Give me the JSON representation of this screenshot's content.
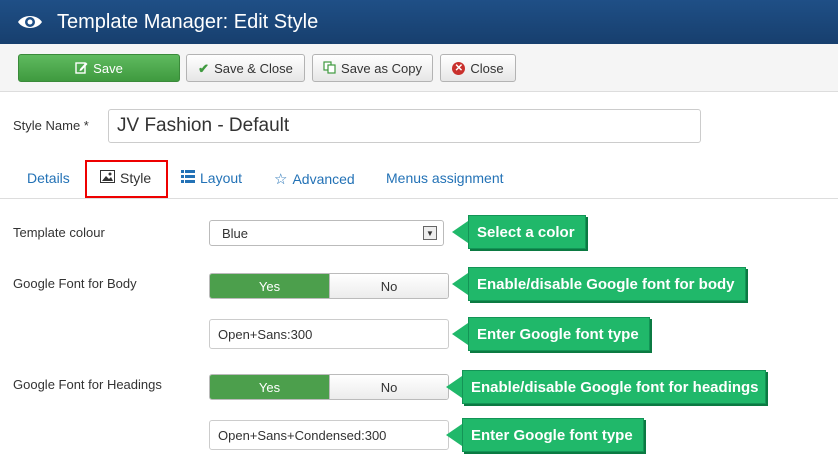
{
  "header": {
    "title": "Template Manager: Edit Style",
    "icon": "eye-icon"
  },
  "toolbar": {
    "save_label": "Save",
    "save_close_label": "Save & Close",
    "save_copy_label": "Save as Copy",
    "close_label": "Close"
  },
  "form": {
    "style_name_label": "Style Name *",
    "style_name_value": "JV Fashion - Default"
  },
  "tabs": [
    {
      "label": "Details"
    },
    {
      "label": "Style"
    },
    {
      "label": "Layout"
    },
    {
      "label": "Advanced"
    },
    {
      "label": "Menus assignment"
    }
  ],
  "fields": {
    "template_colour": {
      "label": "Template colour",
      "value": "Blue"
    },
    "google_font_body": {
      "label": "Google Font for Body",
      "yes": "Yes",
      "no": "No",
      "font_value": "Open+Sans:300"
    },
    "google_font_headings": {
      "label": "Google Font for Headings",
      "yes": "Yes",
      "no": "No",
      "font_value": "Open+Sans+Condensed:300"
    }
  },
  "callouts": {
    "select_color": "Select a color",
    "body_toggle": "Enable/disable Google font for body",
    "body_font_type": "Enter Google font type",
    "headings_toggle": "Enable/disable Google font for headings",
    "headings_font_type": "Enter Google font type"
  },
  "colors": {
    "header_bg": "#1f4f86",
    "save_green": "#4cae4c",
    "callout_green": "#20b86a",
    "highlight_red": "#e00000",
    "tab_blue": "#2372b6"
  }
}
